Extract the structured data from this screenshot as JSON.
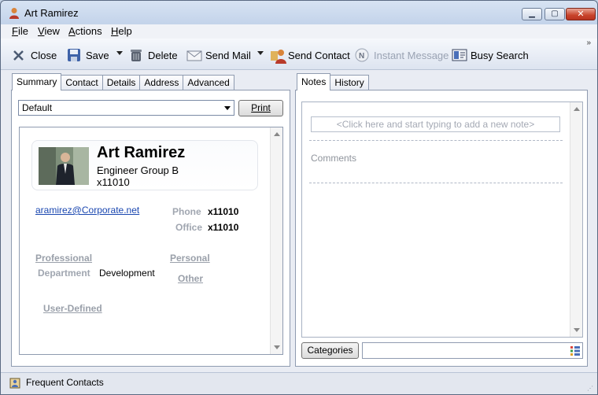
{
  "window": {
    "title": "Art Ramirez",
    "controls": {
      "minimize": "▁",
      "maximize": "▢",
      "close": "✕"
    }
  },
  "menu": {
    "file": "File",
    "view": "View",
    "actions": "Actions",
    "help": "Help"
  },
  "toolbar": {
    "close": "Close",
    "save": "Save",
    "delete": "Delete",
    "send_mail": "Send Mail",
    "send_contact": "Send Contact",
    "instant_message": "Instant Message",
    "busy_search": "Busy Search",
    "overflow": "»"
  },
  "left_tabs": [
    "Summary",
    "Contact",
    "Details",
    "Address",
    "Advanced"
  ],
  "right_tabs": [
    "Notes",
    "History"
  ],
  "summary": {
    "view_select": "Default",
    "print_button": "Print",
    "name": "Art Ramirez",
    "company": "Engineer Group B",
    "extension": "x11010",
    "email": "aramirez@Corporate.net",
    "phone_label": "Phone",
    "phone_value": "x11010",
    "office_label": "Office",
    "office_value": "x11010",
    "professional_section": "Professional",
    "personal_section": "Personal",
    "department_label": "Department",
    "department_value": "Development",
    "other_section": "Other",
    "user_defined_section": "User-Defined"
  },
  "notes": {
    "new_note_placeholder": "<Click here and start typing to add a new note>",
    "comments_label": "Comments",
    "categories_button": "Categories",
    "categories_value": ""
  },
  "status": {
    "label": "Frequent Contacts"
  },
  "colors": {
    "link": "#1a47b0",
    "label_gray": "#a0a6b0",
    "close_red": "#c8432b"
  }
}
